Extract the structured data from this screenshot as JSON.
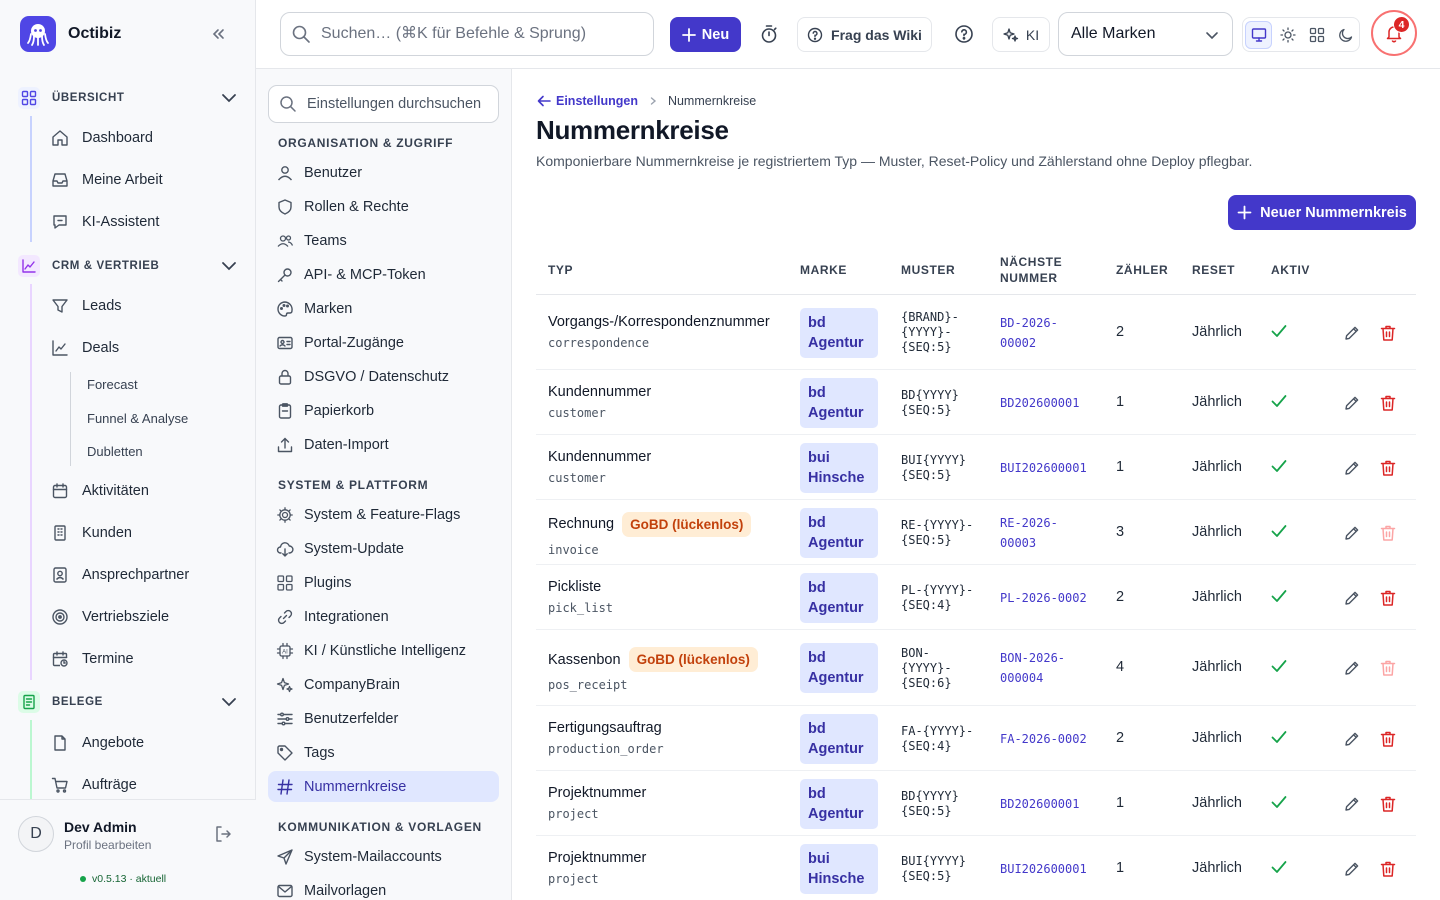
{
  "app": {
    "name": "Octibiz"
  },
  "topbar": {
    "search_placeholder": "Suchen… (⌘K für Befehle & Sprung)",
    "new_label": "Neu",
    "wiki_label": "Frag das Wiki",
    "ki_label": "KI",
    "brand_select_value": "Alle Marken",
    "notification_count": "4"
  },
  "sidebar": {
    "sections": [
      {
        "label": "ÜBERSICHT",
        "items": [
          "Dashboard",
          "Meine Arbeit",
          "KI-Assistent"
        ]
      },
      {
        "label": "CRM & VERTRIEB",
        "items": [
          "Leads",
          "Deals",
          "Aktivitäten",
          "Kunden",
          "Ansprechpartner",
          "Vertriebsziele",
          "Termine"
        ],
        "subitems": [
          "Forecast",
          "Funnel & Analyse",
          "Dubletten"
        ]
      },
      {
        "label": "BELEGE",
        "items": [
          "Angebote",
          "Aufträge"
        ]
      }
    ],
    "user": {
      "name": "Dev Admin",
      "subtitle": "Profil bearbeiten",
      "initial": "D"
    },
    "version": "v0.5.13 · aktuell"
  },
  "settings_nav": {
    "search_placeholder": "Einstellungen durchsuchen",
    "groups": [
      {
        "label": "ORGANISATION & ZUGRIFF",
        "items": [
          "Benutzer",
          "Rollen & Rechte",
          "Teams",
          "API- & MCP-Token",
          "Marken",
          "Portal-Zugänge",
          "DSGVO / Datenschutz",
          "Papierkorb",
          "Daten-Import"
        ]
      },
      {
        "label": "SYSTEM & PLATTFORM",
        "items": [
          "System & Feature-Flags",
          "System-Update",
          "Plugins",
          "Integrationen",
          "KI / Künstliche Intelligenz",
          "CompanyBrain",
          "Benutzerfelder",
          "Tags",
          "Nummernkreise"
        ]
      },
      {
        "label": "KOMMUNIKATION & VORLAGEN",
        "items": [
          "System-Mailaccounts",
          "Mailvorlagen"
        ]
      }
    ],
    "active": "Nummernkreise"
  },
  "main": {
    "breadcrumb": {
      "parent": "Einstellungen",
      "current": "Nummernkreise"
    },
    "title": "Nummernkreise",
    "description": "Komponierbare Nummernkreise je registriertem Typ — Muster, Reset-Policy und Zählerstand ohne Deploy pflegbar.",
    "add_button": "Neuer Nummernkreis",
    "table": {
      "headers": {
        "type": "TYP",
        "brand": "MARKE",
        "pattern": "MUSTER",
        "next1": "NÄCHSTE",
        "next2": "NUMMER",
        "counter": "ZÄHLER",
        "reset": "RESET",
        "active": "AKTIV"
      },
      "rows": [
        {
          "name": "Vorgangs-/Korrespondenznummer",
          "key": "correspondence",
          "gobd": "",
          "brand1": "bd",
          "brand2": "Agentur",
          "pattern": [
            "{BRAND}-",
            "{YYYY}-",
            "{SEQ:5}"
          ],
          "next": [
            "BD-2026-",
            "00002"
          ],
          "counter": "2",
          "reset": "Jährlich",
          "delete_enabled": true
        },
        {
          "name": "Kundennummer",
          "key": "customer",
          "gobd": "",
          "brand1": "bd",
          "brand2": "Agentur",
          "pattern": [
            "BD{YYYY}",
            "{SEQ:5}"
          ],
          "next": [
            "BD202600001"
          ],
          "counter": "1",
          "reset": "Jährlich",
          "delete_enabled": true
        },
        {
          "name": "Kundennummer",
          "key": "customer",
          "gobd": "",
          "brand1": "bui",
          "brand2": "Hinsche",
          "pattern": [
            "BUI{YYYY}",
            "{SEQ:5}"
          ],
          "next": [
            "BUI202600001"
          ],
          "counter": "1",
          "reset": "Jährlich",
          "delete_enabled": true
        },
        {
          "name": "Rechnung",
          "key": "invoice",
          "gobd": "GoBD (lückenlos)",
          "brand1": "bd",
          "brand2": "Agentur",
          "pattern": [
            "RE-{YYYY}-",
            "{SEQ:5}"
          ],
          "next": [
            "RE-2026-",
            "00003"
          ],
          "counter": "3",
          "reset": "Jährlich",
          "delete_enabled": false
        },
        {
          "name": "Pickliste",
          "key": "pick_list",
          "gobd": "",
          "brand1": "bd",
          "brand2": "Agentur",
          "pattern": [
            "PL-{YYYY}-",
            "{SEQ:4}"
          ],
          "next": [
            "PL-2026-0002"
          ],
          "counter": "2",
          "reset": "Jährlich",
          "delete_enabled": true
        },
        {
          "name": "Kassenbon",
          "key": "pos_receipt",
          "gobd": "GoBD (lückenlos)",
          "brand1": "bd",
          "brand2": "Agentur",
          "pattern": [
            "BON-",
            "{YYYY}-",
            "{SEQ:6}"
          ],
          "next": [
            "BON-2026-",
            "000004"
          ],
          "counter": "4",
          "reset": "Jährlich",
          "delete_enabled": false
        },
        {
          "name": "Fertigungsauftrag",
          "key": "production_order",
          "gobd": "",
          "brand1": "bd",
          "brand2": "Agentur",
          "pattern": [
            "FA-{YYYY}-",
            "{SEQ:4}"
          ],
          "next": [
            "FA-2026-0002"
          ],
          "counter": "2",
          "reset": "Jährlich",
          "delete_enabled": true
        },
        {
          "name": "Projektnummer",
          "key": "project",
          "gobd": "",
          "brand1": "bd",
          "brand2": "Agentur",
          "pattern": [
            "BD{YYYY}",
            "{SEQ:5}"
          ],
          "next": [
            "BD202600001"
          ],
          "counter": "1",
          "reset": "Jährlich",
          "delete_enabled": true
        },
        {
          "name": "Projektnummer",
          "key": "project",
          "gobd": "",
          "brand1": "bui",
          "brand2": "Hinsche",
          "pattern": [
            "BUI{YYYY}",
            "{SEQ:5}"
          ],
          "next": [
            "BUI202600001"
          ],
          "counter": "1",
          "reset": "Jährlich",
          "delete_enabled": true
        }
      ]
    }
  },
  "colors": {
    "accent": "#4338ca",
    "active_nav_bg": "#e0e7ff",
    "gobd_bg": "#ffedd5",
    "gobd_text": "#c2410c",
    "check": "#16a34a",
    "delete": "#dc2626"
  }
}
